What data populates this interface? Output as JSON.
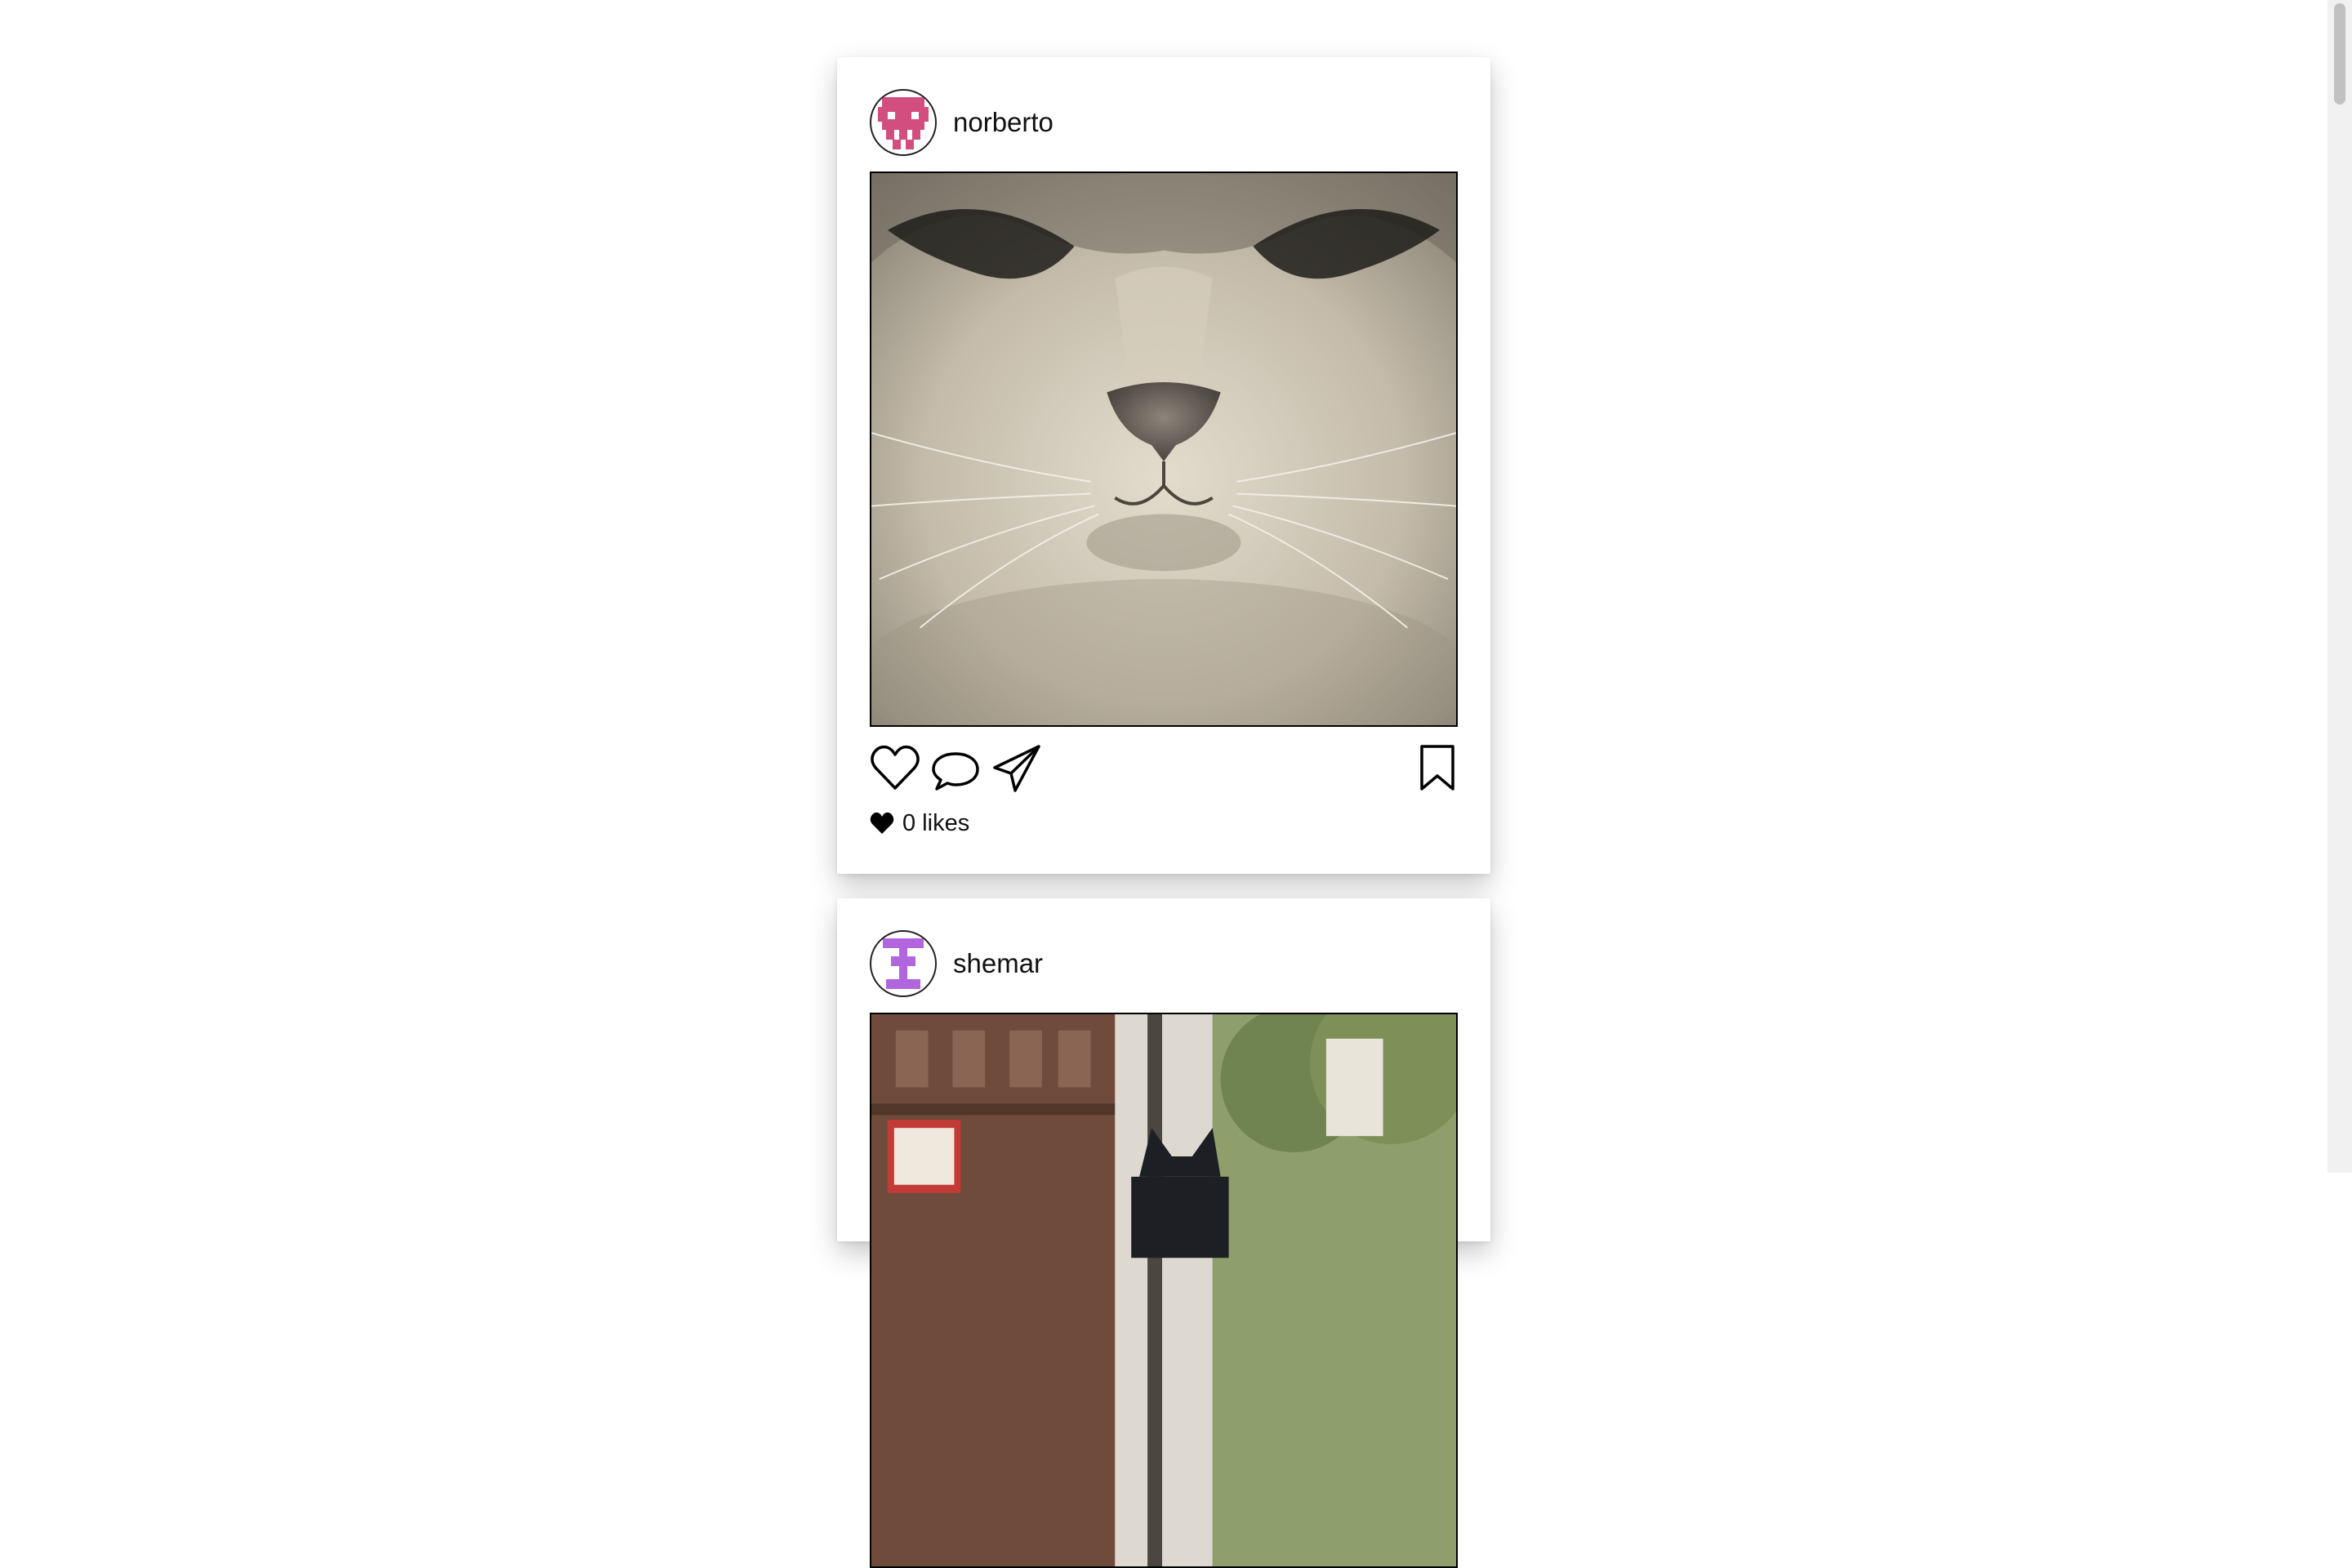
{
  "posts": [
    {
      "username": "norberto",
      "avatar_icon": "pixel-avatar-icon",
      "avatar_color": "#d24e7f",
      "image_subject": "cat-face-photo",
      "likes_count": 0,
      "likes_label": "0 likes"
    },
    {
      "username": "shemar",
      "avatar_icon": "pixel-avatar-icon",
      "avatar_color": "#b266dd",
      "image_subject": "street-cat-statue-photo"
    }
  ],
  "actions": {
    "like_icon": "heart-outline-icon",
    "comment_icon": "speech-bubble-icon",
    "share_icon": "paper-plane-icon",
    "save_icon": "bookmark-icon",
    "likes_icon": "heart-filled-icon"
  },
  "colors": {
    "background": "#ffffff",
    "card": "#ffffff",
    "text": "#111111"
  }
}
